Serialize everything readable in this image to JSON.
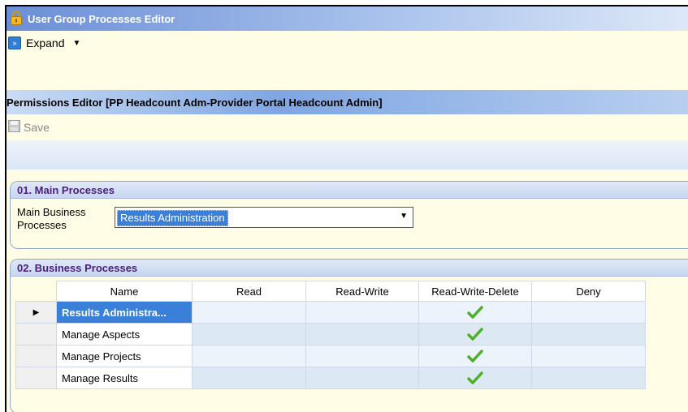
{
  "window": {
    "title": "User Group Processes Editor",
    "expand_label": "Expand"
  },
  "editor": {
    "title": "Permissions Editor [PP Headcount Adm-Provider Portal Headcount Admin]",
    "save_label": "Save"
  },
  "main_processes": {
    "header": "01. Main Processes",
    "field_label": "Main Business Processes",
    "selected_value": "Results Administration"
  },
  "business_processes": {
    "header": "02. Business Processes",
    "columns": [
      "Name",
      "Read",
      "Read-Write",
      "Read-Write-Delete",
      "Deny"
    ],
    "rows": [
      {
        "name": "Results Administra...",
        "read": false,
        "read_write": false,
        "read_write_delete": true,
        "deny": false
      },
      {
        "name": "Manage Aspects",
        "read": false,
        "read_write": false,
        "read_write_delete": true,
        "deny": false
      },
      {
        "name": "Manage Projects",
        "read": false,
        "read_write": false,
        "read_write_delete": true,
        "deny": false
      },
      {
        "name": "Manage Results",
        "read": false,
        "read_write": false,
        "read_write_delete": true,
        "deny": false
      }
    ]
  },
  "colors": {
    "title_gradient": "#6b8fd6",
    "selection": "#3a7fd8",
    "group_header_text": "#4a1e7a",
    "check_green": "#4fae2a",
    "background": "#fffde6"
  },
  "icons": {
    "title": "lock-icon",
    "expand": "expand-icon",
    "save": "floppy-disk-icon",
    "row_indicator": "triangle-right-icon",
    "permission": "checkmark-icon"
  }
}
